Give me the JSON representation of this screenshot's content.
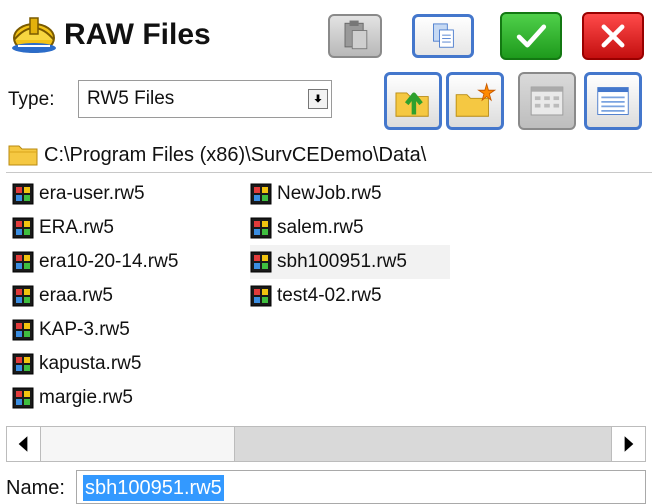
{
  "window": {
    "title": "RAW Files"
  },
  "toolbar": {
    "icons": [
      "clipboard-icon",
      "copy-icon",
      "check-icon",
      "close-icon",
      "folder-up-icon",
      "new-folder-icon",
      "list-view-icon",
      "details-view-icon"
    ]
  },
  "type": {
    "label": "Type:",
    "value": "RW5 Files"
  },
  "path": {
    "text": "C:\\Program Files (x86)\\SurvCEDemo\\Data\\"
  },
  "files": {
    "col1": [
      "era-user.rw5",
      "ERA.rw5",
      "era10-20-14.rw5",
      "eraa.rw5",
      "KAP-3.rw5",
      "kapusta.rw5",
      "margie.rw5"
    ],
    "col2": [
      "NewJob.rw5",
      "salem.rw5",
      "sbh100951.rw5",
      "test4-02.rw5"
    ],
    "selected": "sbh100951.rw5"
  },
  "name": {
    "label": "Name:",
    "value": "sbh100951.rw5"
  },
  "colors": {
    "accent_blue": "#4477cc",
    "ok_green": "#22aa22",
    "close_red": "#dd1111",
    "selection": "#3399ff"
  }
}
